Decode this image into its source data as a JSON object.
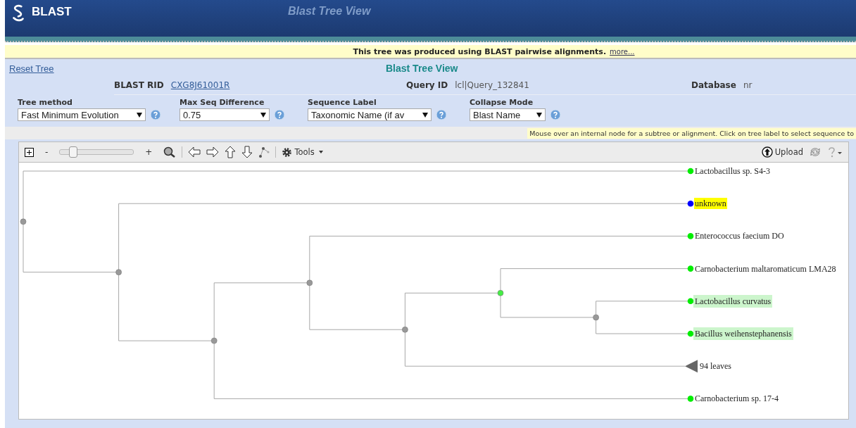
{
  "header": {
    "logo": "BLAST",
    "title": "Blast Tree View"
  },
  "notice": {
    "text": "This tree was produced using BLAST pairwise alignments.",
    "link": "more..."
  },
  "reset_link": "Reset Tree",
  "page_title": "Blast Tree View",
  "info": [
    {
      "label": "BLAST RID",
      "value": "CXG8J61001R",
      "kind": "link"
    },
    {
      "label": "Query ID",
      "value": "lcl|Query_132841",
      "kind": "text"
    },
    {
      "label": "Database",
      "value": "nr",
      "kind": "text"
    }
  ],
  "options": [
    {
      "label": "Tree method",
      "value": "Fast Minimum Evolution"
    },
    {
      "label": "Max Seq Difference",
      "value": "0.75"
    },
    {
      "label": "Sequence Label",
      "value": "Taxonomic Name (if av"
    },
    {
      "label": "Collapse Mode",
      "value": "Blast Name"
    }
  ],
  "hint": "Mouse over an internal node for a subtree or alignment. Click on tree label to select sequence to",
  "toolbar": {
    "zoom_out": "-",
    "zoom_in": "+",
    "zoom_slider": {
      "level": 0.12
    },
    "tools": "Tools",
    "upload": "Upload"
  },
  "tree": {
    "color": "#999999",
    "children": [
      {
        "kind": "leaf",
        "label": "Lactobacillus sp. S4-3",
        "color": "#00ee00",
        "query": false,
        "selected": false
      },
      {
        "color": "#999999",
        "children": [
          {
            "kind": "leaf",
            "label": "unknown",
            "color": "#0000ff",
            "query": true,
            "selected": false
          },
          {
            "color": "#999999",
            "children": [
              {
                "color": "#999999",
                "children": [
                  {
                    "kind": "leaf",
                    "label": "Enterococcus faecium DO",
                    "color": "#00ee00",
                    "query": false,
                    "selected": false
                  },
                  {
                    "color": "#999999",
                    "children": [
                      {
                        "color": "#44ee44",
                        "children": [
                          {
                            "kind": "leaf",
                            "label": "Carnobacterium maltaromaticum LMA28",
                            "color": "#00ee00",
                            "query": false,
                            "selected": false
                          },
                          {
                            "color": "#999999",
                            "children": [
                              {
                                "kind": "leaf",
                                "label": "Lactobacillus curvatus",
                                "color": "#00ee00",
                                "query": false,
                                "selected": true
                              },
                              {
                                "kind": "leaf",
                                "label": "Bacillus weihenstephanensis",
                                "color": "#00ee00",
                                "query": false,
                                "selected": true
                              }
                            ]
                          }
                        ]
                      },
                      {
                        "kind": "collapsed",
                        "label": "94 leaves",
                        "color": "#666666",
                        "query": false,
                        "selected": false
                      }
                    ]
                  }
                ]
              },
              {
                "kind": "leaf",
                "label": "Carnobacterium sp. 17-4",
                "color": "#00ee00",
                "query": false,
                "selected": false
              }
            ]
          }
        ]
      }
    ]
  }
}
